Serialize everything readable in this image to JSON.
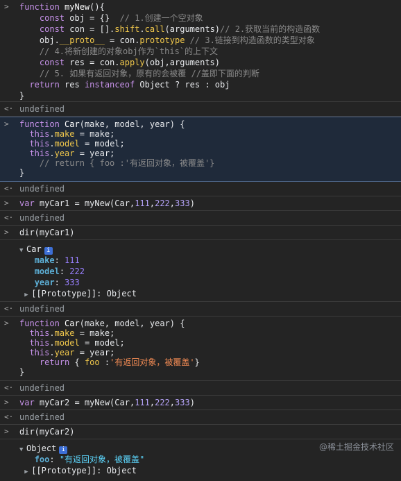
{
  "entries": [
    {
      "type": "input",
      "lines": [
        "function myNew(){",
        "    const obj = {}  // 1.创建一个空对象",
        "    const con = [].shift.call(arguments)// 2.获取当前的构造函数",
        "    obj.__proto__ = con.prototype // 3.链接到构造函数的类型对象",
        "    // 4.将新创建的对象obj作为`this`的上下文",
        "    const res = con.apply(obj,arguments)",
        "    // 5. 如果有返回对象，原有的会被覆 //盖即下面的判断",
        "  return res instanceof Object ? res : obj",
        "}"
      ]
    },
    {
      "type": "output",
      "text": "undefined"
    },
    {
      "type": "input",
      "lines": [
        "function Car(make, model, year) {",
        "  this.make = make;",
        "  this.model = model;",
        "  this.year = year;",
        "    // return { foo :'有返回对象，被覆盖'}",
        "}"
      ]
    },
    {
      "type": "output",
      "text": "undefined"
    },
    {
      "type": "input",
      "lines": [
        "var myCar1 = myNew(Car,111,222,333)"
      ]
    },
    {
      "type": "output",
      "text": "undefined"
    },
    {
      "type": "input",
      "lines": [
        "dir(myCar1)"
      ]
    },
    {
      "type": "object",
      "name": "Car",
      "props": [
        {
          "key": "make",
          "value": "111"
        },
        {
          "key": "model",
          "value": "222"
        },
        {
          "key": "year",
          "value": "333"
        }
      ],
      "proto": "[[Prototype]]: Object"
    },
    {
      "type": "output",
      "text": "undefined"
    },
    {
      "type": "input",
      "lines": [
        "function Car(make, model, year) {",
        "  this.make = make;",
        "  this.model = model;",
        "  this.year = year;",
        "    return { foo :'有返回对象，被覆盖'}",
        "}"
      ]
    },
    {
      "type": "output",
      "text": "undefined"
    },
    {
      "type": "input",
      "lines": [
        "var myCar2 = myNew(Car,111,222,333)"
      ]
    },
    {
      "type": "output",
      "text": "undefined"
    },
    {
      "type": "input",
      "lines": [
        "dir(myCar2)"
      ]
    },
    {
      "type": "object",
      "name": "Object",
      "props": [
        {
          "key": "foo",
          "value": "\"有返回对象，被覆盖\""
        }
      ],
      "proto": "[[Prototype]]: Object"
    }
  ],
  "gutter": {
    "input": ">",
    "output": "<·"
  },
  "watermark": "@稀土掘金技术社区"
}
